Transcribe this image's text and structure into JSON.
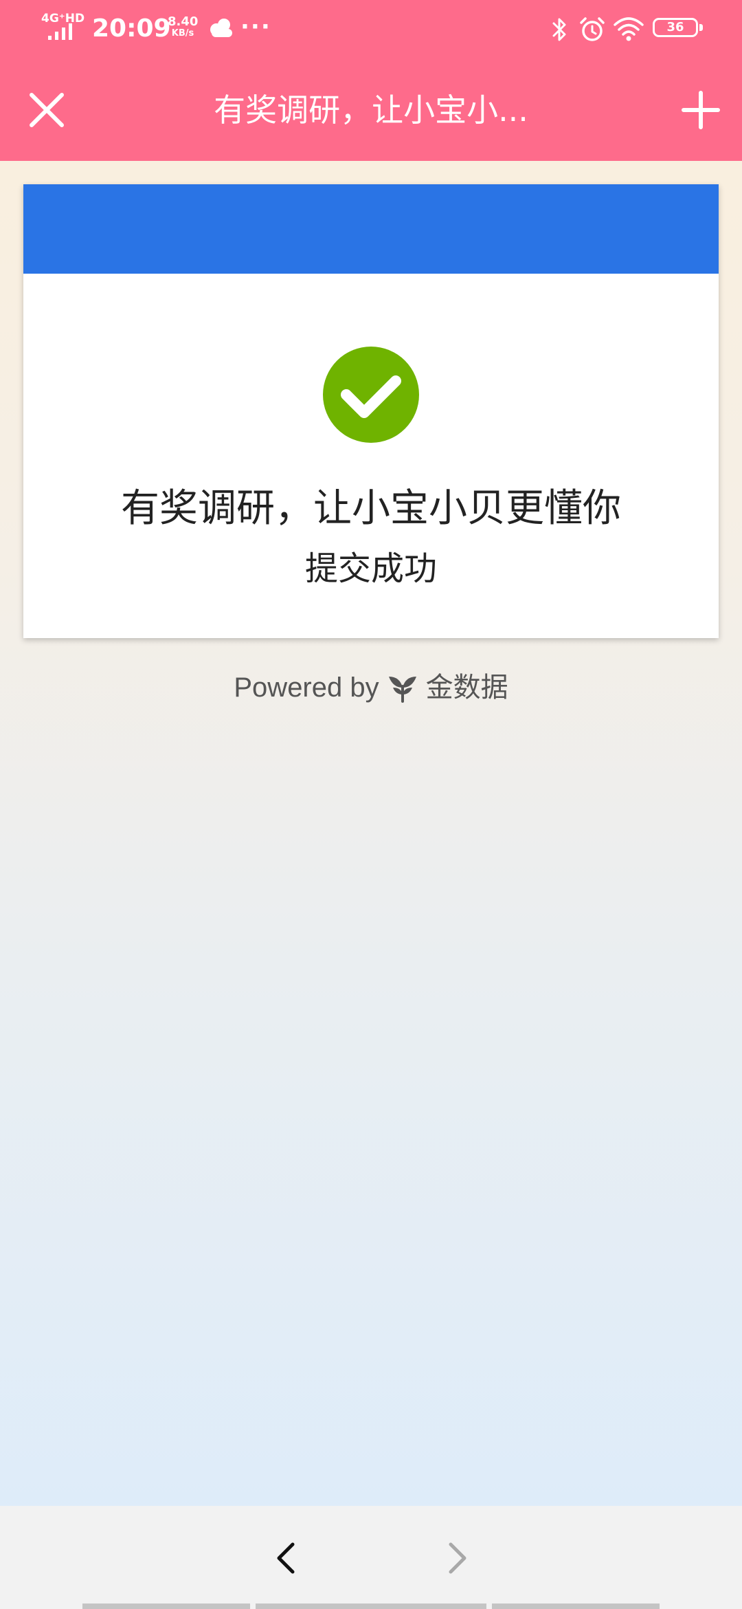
{
  "status_bar": {
    "network": "4G⁺HD",
    "time": "20:09",
    "speed_value": "8.40",
    "speed_unit": "KB/s",
    "more": "···",
    "battery": "36",
    "icons": [
      "signal-icon",
      "cloud-icon",
      "bluetooth-icon",
      "alarm-icon",
      "wifi-icon",
      "battery-icon"
    ]
  },
  "header": {
    "title": "有奖调研，让小宝小...",
    "close_icon": "close-icon",
    "add_icon": "plus-icon",
    "background": "#fe6b8b"
  },
  "card": {
    "banner_color": "#2a74e5",
    "success_icon": "check-circle-icon",
    "success_color": "#6fb300",
    "title": "有奖调研，让小宝小贝更懂你",
    "message": "提交成功"
  },
  "footer": {
    "powered_by": "Powered by",
    "brand_icon": "sprout-logo-icon",
    "brand": "金数据"
  },
  "bottom_nav": {
    "back_icon": "chevron-left-icon",
    "forward_icon": "chevron-right-icon"
  }
}
